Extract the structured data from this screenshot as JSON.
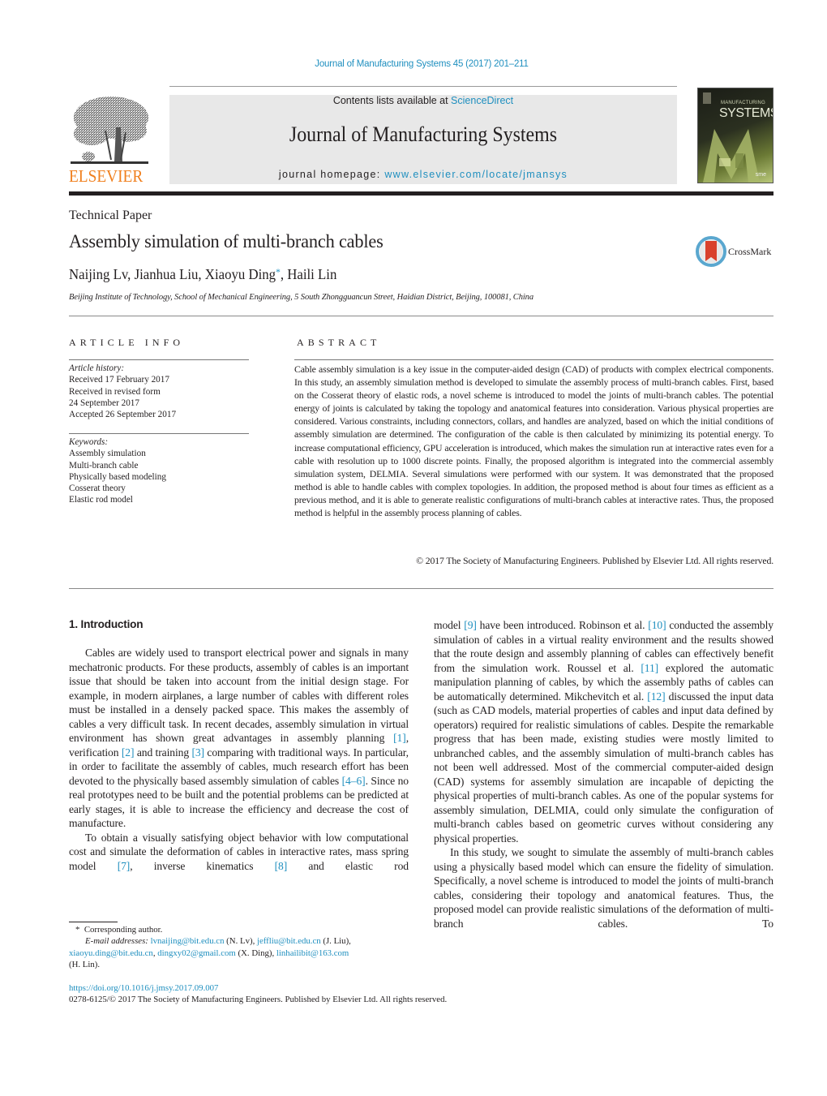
{
  "header": {
    "running_head": "Journal of Manufacturing Systems 45 (2017) 201–211",
    "contents_prefix": "Contents lists available at ",
    "contents_link": "ScienceDirect",
    "journal_title": "Journal of Manufacturing Systems",
    "homepage_prefix": "journal homepage: ",
    "homepage_link": "www.elsevier.com/locate/jmansys",
    "publisher_logo_text": "ELSEVIER",
    "cover": {
      "title": "SYSTEMS",
      "subtitle": "MANUFACTURING",
      "badge": "sme"
    }
  },
  "article": {
    "type": "Technical Paper",
    "title": "Assembly simulation of multi-branch cables",
    "crossmark_label": "CrossMark",
    "authors": {
      "before_star": "Naijing Lv, Jianhua Liu, Xiaoyu Ding",
      "star": "*",
      "after_star": ", Haili Lin"
    },
    "affiliation": "Beijing Institute of Technology, School of Mechanical Engineering, 5 South Zhongguancun Street, Haidian District, Beijing, 100081, China"
  },
  "article_info": {
    "heading": "ARTICLE INFO",
    "history_label": "Article history:",
    "history": [
      "Received 17 February 2017",
      "Received in revised form",
      "24 September 2017",
      "Accepted 26 September 2017"
    ],
    "keywords_label": "Keywords:",
    "keywords": [
      "Assembly simulation",
      "Multi-branch cable",
      "Physically based modeling",
      "Cosserat theory",
      "Elastic rod model"
    ]
  },
  "abstract": {
    "heading": "ABSTRACT",
    "text": "Cable assembly simulation is a key issue in the computer-aided design (CAD) of products with complex electrical components. In this study, an assembly simulation method is developed to simulate the assembly process of multi-branch cables. First, based on the Cosserat theory of elastic rods, a novel scheme is introduced to model the joints of multi-branch cables. The potential energy of joints is calculated by taking the topology and anatomical features into consideration. Various physical properties are considered. Various constraints, including connectors, collars, and handles are analyzed, based on which the initial conditions of assembly simulation are determined. The configuration of the cable is then calculated by minimizing its potential energy. To increase computational efficiency, GPU acceleration is introduced, which makes the simulation run at interactive rates even for a cable with resolution up to 1000 discrete points. Finally, the proposed algorithm is integrated into the commercial assembly simulation system, DELMIA. Several simulations were performed with our system. It was demonstrated that the proposed method is able to handle cables with complex topologies. In addition, the proposed method is about four times as efficient as a previous method, and it is able to generate realistic configurations of multi-branch cables at interactive rates. Thus, the proposed method is helpful in the assembly process planning of cables.",
    "copyright": "© 2017 The Society of Manufacturing Engineers. Published by Elsevier Ltd. All rights reserved."
  },
  "body": {
    "section_heading": "1.  Introduction",
    "left_col": {
      "p1": {
        "t1": "Cables are widely used to transport electrical power and signals in many mechatronic products. For these products, assembly of cables is an important issue that should be taken into account from the initial design stage. For example, in modern airplanes, a large number of cables with different roles must be installed in a densely packed space. This makes the assembly of cables a very difficult task. In recent decades, assembly simulation in virtual environment has shown great advantages in assembly planning ",
        "r1": "[1]",
        "t2": ", verification ",
        "r2": "[2]",
        "t3": " and training ",
        "r3": "[3]",
        "t4": " comparing with traditional ways. In particular, in order to facilitate the assembly of cables, much research effort has been devoted to the physically based assembly simulation of cables ",
        "r4": "[4–6]",
        "t5": ". Since no real prototypes need to be built and the potential problems can be predicted at early stages, it is able to increase the efficiency and decrease the cost of manufacture."
      },
      "p2": {
        "t1": "To obtain a visually satisfying object behavior with low computational cost and simulate the deformation of cables in interactive rates, mass spring model ",
        "r1": "[7]",
        "t2": ", inverse kinematics ",
        "r2": "[8]",
        "t3": " and elastic rod"
      }
    },
    "right_col": {
      "p1": {
        "t1": "model ",
        "r1": "[9]",
        "t2": " have been introduced. Robinson et al. ",
        "r2": "[10]",
        "t3": " conducted the assembly simulation of cables in a virtual reality environment and the results showed that the route design and assembly planning of cables can effectively benefit from the simulation work. Roussel et al. ",
        "r3": "[11]",
        "t4": " explored the automatic manipulation planning of cables, by which the assembly paths of cables can be automatically determined. Mikchevitch et al. ",
        "r4": "[12]",
        "t5": " discussed the input data (such as CAD models, material properties of cables and input data defined by operators) required for realistic simulations of cables. Despite the remarkable progress that has been made, existing studies were mostly limited to unbranched cables, and the assembly simulation of multi-branch cables has not been well addressed. Most of the commercial computer-aided design (CAD) systems for assembly simulation are incapable of depicting the physical properties of multi-branch cables. As one of the popular systems for assembly simulation, DELMIA, could only simulate the configuration of multi-branch cables based on geometric curves without considering any physical properties."
      },
      "p2": "In this study, we sought to simulate the assembly of multi-branch cables using a physically based model which can ensure the fidelity of simulation. Specifically, a novel scheme is introduced to model the joints of multi-branch cables, considering their topology and anatomical features. Thus, the proposed model can provide realistic simulations of the deformation of multi-branch cables. To"
    }
  },
  "footnotes": {
    "star": "*",
    "corresponding": "Corresponding author.",
    "email_label": "E-mail addresses:",
    "emails": [
      {
        "address": "lvnaijing@bit.edu.cn",
        "owner": " (N. Lv), "
      },
      {
        "address": "jeffliu@bit.edu.cn",
        "owner": " (J. Liu),"
      },
      {
        "address": "xiaoyu.ding@bit.edu.cn",
        "owner": ", "
      },
      {
        "address": "dingxy02@gmail.com",
        "owner": " (X. Ding), "
      },
      {
        "address": "linhailibit@163.com",
        "owner": ""
      }
    ],
    "last_owner": "(H. Lin).",
    "doi": "https://doi.org/10.1016/j.jmsy.2017.09.007",
    "issn_line": "0278-6125/© 2017 The Society of Manufacturing Engineers. Published by Elsevier Ltd. All rights reserved."
  },
  "colors": {
    "link": "#1f8fbf",
    "elsevier_orange": "#f07f1d",
    "masthead_bg": "#e8e8e8",
    "text": "#231f20"
  }
}
